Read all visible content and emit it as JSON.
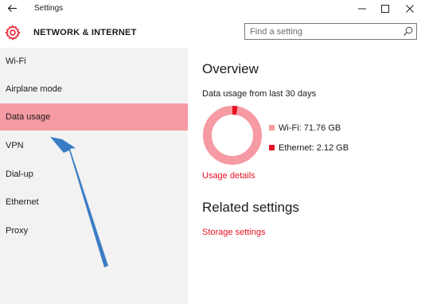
{
  "window": {
    "title": "Settings",
    "controls": {
      "back_icon": "back-arrow-icon",
      "minimize_icon": "minimize-icon",
      "maximize_icon": "maximize-icon",
      "close_icon": "close-icon"
    }
  },
  "header": {
    "icon": "gear-icon",
    "title": "NETWORK & INTERNET",
    "search": {
      "placeholder": "Find a setting",
      "value": ""
    }
  },
  "sidebar": {
    "items": [
      {
        "label": "Wi-Fi",
        "selected": false
      },
      {
        "label": "Airplane mode",
        "selected": false
      },
      {
        "label": "Data usage",
        "selected": true
      },
      {
        "label": "VPN",
        "selected": false
      },
      {
        "label": "Dial-up",
        "selected": false
      },
      {
        "label": "Ethernet",
        "selected": false
      },
      {
        "label": "Proxy",
        "selected": false
      }
    ]
  },
  "main": {
    "overview_heading": "Overview",
    "usage_caption": "Data usage from last 30 days",
    "legend": [
      {
        "label": "Wi-Fi: 71.76 GB",
        "value_gb": 71.76,
        "color": "#f69aa3"
      },
      {
        "label": "Ethernet: 2.12 GB",
        "value_gb": 2.12,
        "color": "#e81123"
      }
    ],
    "usage_details_link": "Usage details",
    "related_heading": "Related settings",
    "storage_settings_link": "Storage settings"
  },
  "colors": {
    "accent": "#e81123",
    "selection": "#f69aa3",
    "sidebar_bg": "#f2f2f2",
    "annotation_arrow": "#3a7cc4"
  }
}
